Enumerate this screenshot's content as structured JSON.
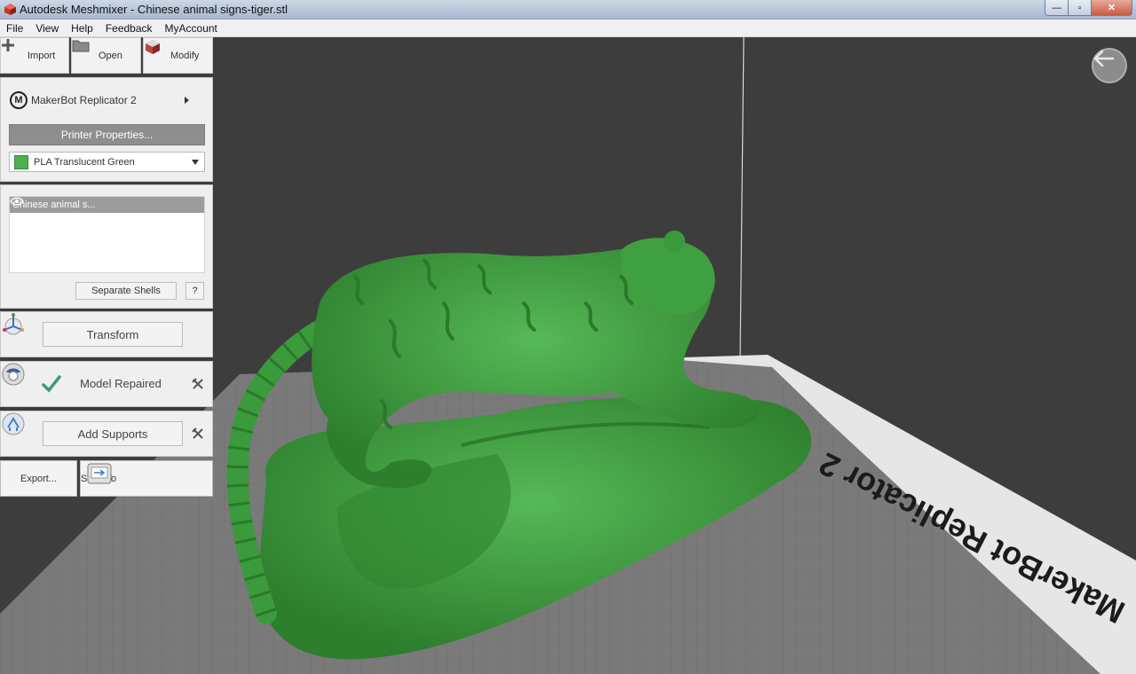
{
  "window": {
    "title": "Autodesk Meshmixer - Chinese animal signs-tiger.stl",
    "controls": {
      "minimize": "—",
      "maximize": "▫",
      "close": "✕"
    }
  },
  "menu": [
    "File",
    "View",
    "Help",
    "Feedback",
    "MyAccount"
  ],
  "toolbar": {
    "import_label": "Import",
    "open_label": "Open",
    "modify_label": "Modify"
  },
  "printer": {
    "logo": "M",
    "name": "MakerBot Replicator 2",
    "properties_label": "Printer Properties...",
    "material": "PLA Translucent Green",
    "material_color": "#4fae4f"
  },
  "objects": {
    "items": [
      "Chinese animal s..."
    ],
    "separate_shells_label": "Separate Shells",
    "help_label": "?"
  },
  "steps": {
    "transform_label": "Transform",
    "repair_label": "Model Repaired",
    "supports_label": "Add Supports"
  },
  "export": {
    "export_label": "Export...",
    "send_to_label": "Send To"
  },
  "viewport": {
    "bed_label": "MakerBot Replicator 2",
    "model_color": "#3c9b3c",
    "background_color": "#3d3d3d"
  }
}
